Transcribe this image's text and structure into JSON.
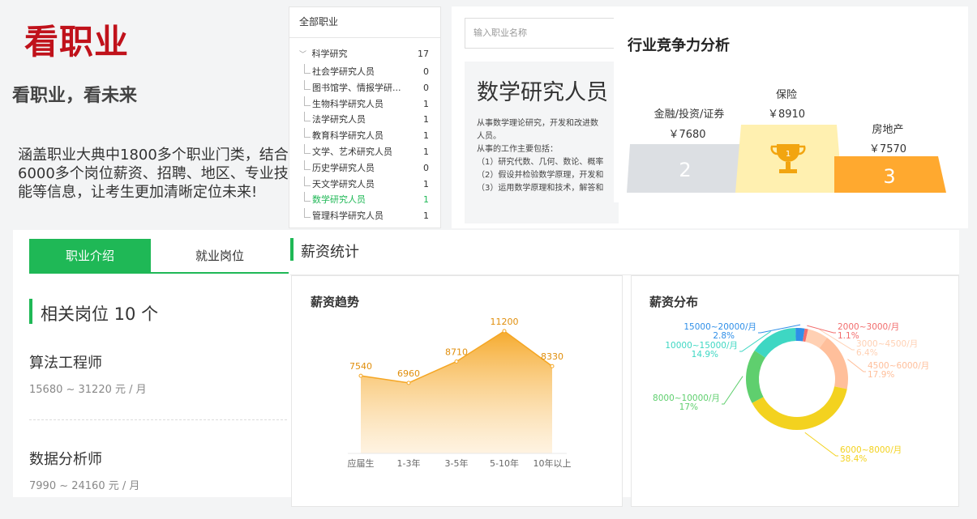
{
  "hero": {
    "title": "看职业",
    "subtitle": "看职业，看未来",
    "description": "涵盖职业大典中1800多个职业门类，结合6000多个岗位薪资、招聘、地区、专业技能等信息，让考生更加清晰定位未来!"
  },
  "tree": {
    "header": "全部职业",
    "group": {
      "label": "科学研究",
      "count": "17"
    },
    "items": [
      {
        "label": "社会学研究人员",
        "count": "0"
      },
      {
        "label": "图书馆学、情报学研...",
        "count": "0"
      },
      {
        "label": "生物科学研究人员",
        "count": "1"
      },
      {
        "label": "法学研究人员",
        "count": "1"
      },
      {
        "label": "教育科学研究人员",
        "count": "1"
      },
      {
        "label": "文学、艺术研究人员",
        "count": "1"
      },
      {
        "label": "历史学研究人员",
        "count": "0"
      },
      {
        "label": "天文学研究人员",
        "count": "1"
      },
      {
        "label": "数学研究人员",
        "count": "1",
        "active": true
      },
      {
        "label": "管理科学研究人员",
        "count": "1"
      }
    ]
  },
  "search": {
    "placeholder": "输入职业名称"
  },
  "job": {
    "title": "数学研究人员",
    "lines": [
      "从事数学理论研究，开发和改进数",
      "人员。",
      "从事的工作主要包括：",
      "（1）研究代数、几何、数论、概率",
      "（2）假设并检验数学原理，开发和",
      "（3）运用数学原理和技术，解答和"
    ]
  },
  "competitiveness": {
    "title": "行业竞争力分析",
    "podium": [
      {
        "rank": "2",
        "name": "金融/投资/证券",
        "salary": "￥7680"
      },
      {
        "rank": "1",
        "name": "保险",
        "salary": "￥8910"
      },
      {
        "rank": "3",
        "name": "房地产",
        "salary": "￥7570"
      }
    ],
    "trophy_rank": "1",
    "colors": {
      "second": "#dcdfe3",
      "first": "#fff0b0",
      "third": "#ffa92f"
    }
  },
  "tabs": {
    "intro": "职业介绍",
    "jobs": "就业岗位"
  },
  "related": {
    "title": "相关岗位 10 个",
    "jobs": [
      {
        "name": "算法工程师",
        "pay": "15680 ~ 31220 元 / 月"
      },
      {
        "name": "数据分析师",
        "pay": "7990 ~ 24160 元 / 月"
      }
    ]
  },
  "salary": {
    "section_title": "薪资统计",
    "trend_title": "薪资趋势",
    "dist_title": "薪资分布"
  },
  "chart_data": [
    {
      "type": "area",
      "title": "薪资趋势",
      "categories": [
        "应届生",
        "1-3年",
        "3-5年",
        "5-10年",
        "10年以上"
      ],
      "values": [
        7540,
        6960,
        8710,
        11200,
        8330
      ],
      "ylim": [
        0,
        12000
      ],
      "color": "#f5a623"
    },
    {
      "type": "pie",
      "title": "薪资分布",
      "donut": true,
      "slices": [
        {
          "label": "2000~3000/月",
          "pct": "1.1%",
          "value": 1.1,
          "color": "#f26d6d"
        },
        {
          "label": "3000~4500/月",
          "pct": "6.4%",
          "value": 6.4,
          "color": "#ffd0b3"
        },
        {
          "label": "4500~6000/月",
          "pct": "17.9%",
          "value": 17.9,
          "color": "#ffbf9b"
        },
        {
          "label": "6000~8000/月",
          "pct": "38.4%",
          "value": 38.4,
          "color": "#f3d21f"
        },
        {
          "label": "8000~10000/月",
          "pct": "17%",
          "value": 17,
          "color": "#5fcf6e"
        },
        {
          "label": "10000~15000/月",
          "pct": "14.9%",
          "value": 14.9,
          "color": "#3ed7c3"
        },
        {
          "label": "15000~20000/月",
          "pct": "2.8%",
          "value": 2.8,
          "color": "#2f8fe8"
        }
      ]
    }
  ]
}
